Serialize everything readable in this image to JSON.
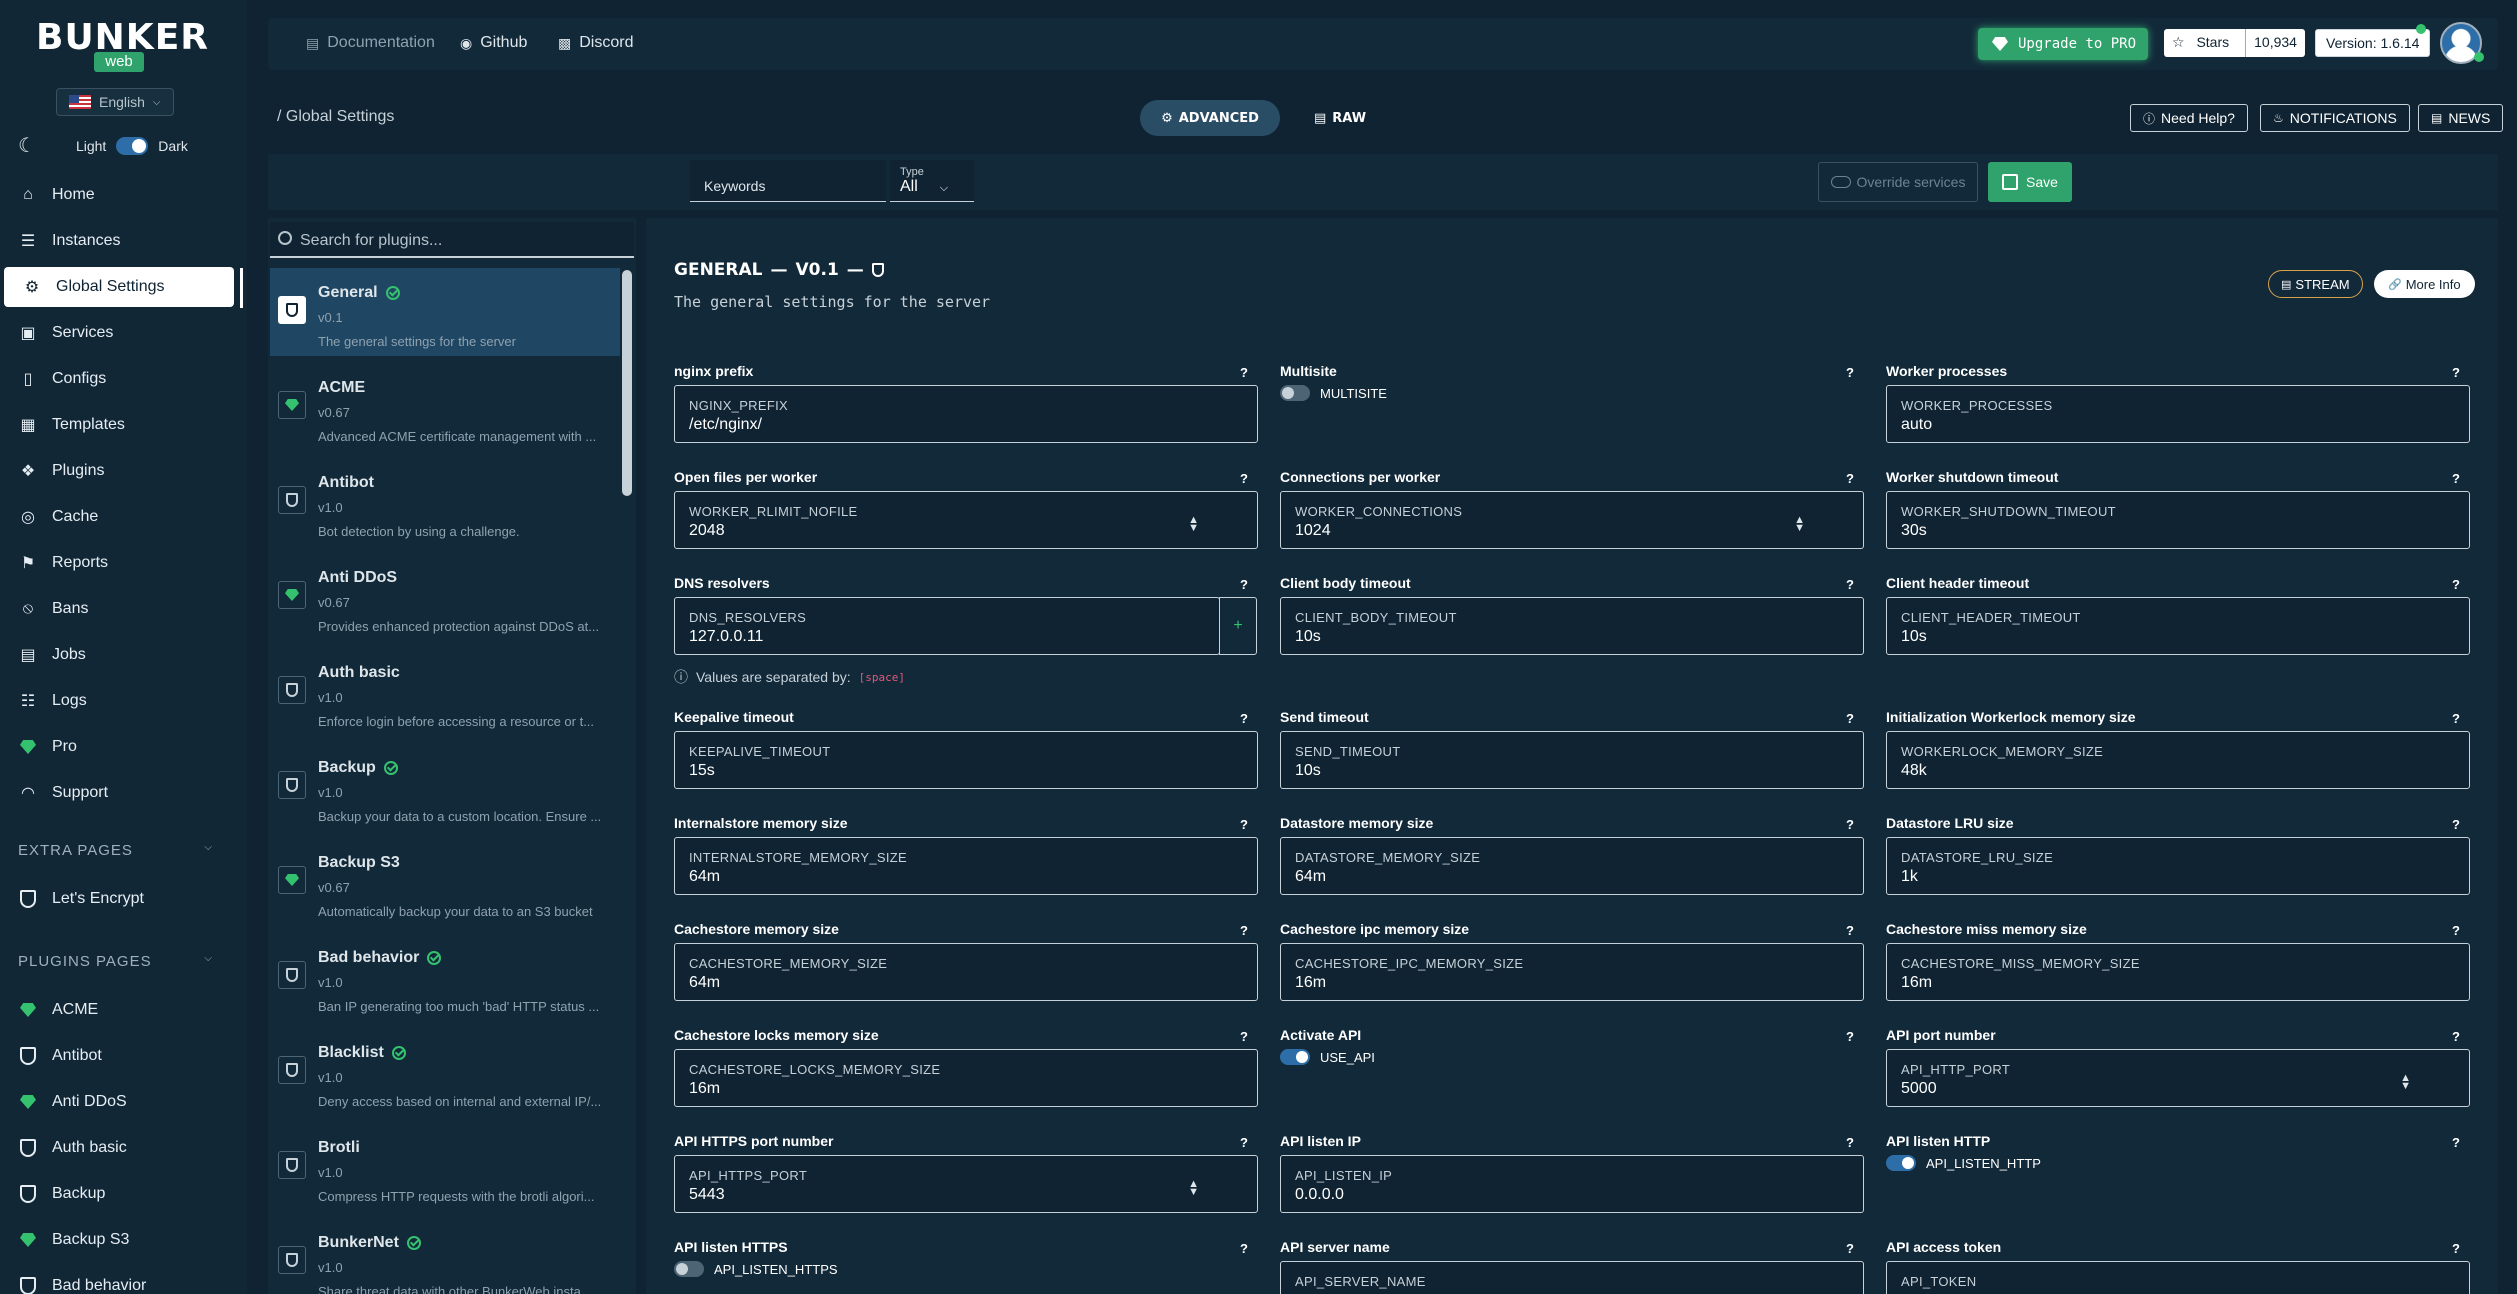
{
  "brand": {
    "name": "BUNKER",
    "sub": "web"
  },
  "language": "English",
  "theme": {
    "light": "Light",
    "dark": "Dark"
  },
  "nav": [
    {
      "label": "Home",
      "icon": "home-icon"
    },
    {
      "label": "Instances",
      "icon": "server-icon"
    },
    {
      "label": "Global Settings",
      "icon": "gear-icon"
    },
    {
      "label": "Services",
      "icon": "cube-icon"
    },
    {
      "label": "Configs",
      "icon": "file-icon"
    },
    {
      "label": "Templates",
      "icon": "layout-icon"
    },
    {
      "label": "Plugins",
      "icon": "puzzle-icon"
    },
    {
      "label": "Cache",
      "icon": "database-icon"
    },
    {
      "label": "Reports",
      "icon": "flag-icon"
    },
    {
      "label": "Bans",
      "icon": "ban-icon"
    },
    {
      "label": "Jobs",
      "icon": "calendar-icon"
    },
    {
      "label": "Logs",
      "icon": "log-icon"
    },
    {
      "label": "Pro",
      "icon": "gem-icon"
    },
    {
      "label": "Support",
      "icon": "headset-icon"
    }
  ],
  "extra_pages": {
    "heading": "EXTRA PAGES",
    "items": [
      "Let's Encrypt"
    ]
  },
  "plugins_pages": {
    "heading": "PLUGINS PAGES",
    "items": [
      "ACME",
      "Antibot",
      "Anti DDoS",
      "Auth basic",
      "Backup",
      "Backup S3",
      "Bad behavior"
    ]
  },
  "header": {
    "links": [
      "Documentation",
      "Github",
      "Discord"
    ],
    "upgrade": "Upgrade to PRO",
    "stars_label": "Stars",
    "stars_count": "10,934",
    "version": "Version: 1.6.14"
  },
  "subheader": {
    "breadcrumb": "/  Global Settings",
    "advanced": "ADVANCED",
    "raw": "RAW",
    "need_help": "Need Help?",
    "notifications": "NOTIFICATIONS",
    "news": "NEWS"
  },
  "toolbar": {
    "keywords": "Keywords",
    "type_label": "Type",
    "type_value": "All",
    "override": "Override services",
    "save": "Save"
  },
  "plugin_search_placeholder": "Search for plugins...",
  "plugins": [
    {
      "name": "General",
      "version": "v0.1",
      "desc": "The general settings for the server",
      "checked": true,
      "icon": "shield"
    },
    {
      "name": "ACME",
      "version": "v0.67",
      "desc": "Advanced ACME certificate management with ...",
      "checked": false,
      "icon": "gem"
    },
    {
      "name": "Antibot",
      "version": "v1.0",
      "desc": "Bot detection by using a challenge.",
      "checked": false,
      "icon": "shield"
    },
    {
      "name": "Anti DDoS",
      "version": "v0.67",
      "desc": "Provides enhanced protection against DDoS at...",
      "checked": false,
      "icon": "gem"
    },
    {
      "name": "Auth basic",
      "version": "v1.0",
      "desc": "Enforce login before accessing a resource or t...",
      "checked": false,
      "icon": "shield"
    },
    {
      "name": "Backup",
      "version": "v1.0",
      "desc": "Backup your data to a custom location. Ensure ...",
      "checked": true,
      "icon": "shield"
    },
    {
      "name": "Backup S3",
      "version": "v0.67",
      "desc": "Automatically backup your data to an S3 bucket",
      "checked": false,
      "icon": "gem"
    },
    {
      "name": "Bad behavior",
      "version": "v1.0",
      "desc": "Ban IP generating too much 'bad' HTTP status ...",
      "checked": true,
      "icon": "shield"
    },
    {
      "name": "Blacklist",
      "version": "v1.0",
      "desc": "Deny access based on internal and external IP/...",
      "checked": true,
      "icon": "shield"
    },
    {
      "name": "Brotli",
      "version": "v1.0",
      "desc": "Compress HTTP requests with the brotli algori...",
      "checked": false,
      "icon": "shield"
    },
    {
      "name": "BunkerNet",
      "version": "v1.0",
      "desc": "Share threat data with other BunkerWeb insta...",
      "checked": true,
      "icon": "shield"
    }
  ],
  "panel": {
    "title": "GENERAL",
    "version": "V0.1",
    "subtitle": "The general settings for the server",
    "stream": "STREAM",
    "more_info": "More Info",
    "hint_text": "Values are separated by:",
    "hint_code": "[space]"
  },
  "fields": [
    {
      "label": "nginx prefix",
      "key": "NGINX_PREFIX",
      "value": "/etc/nginx/",
      "kind": "text"
    },
    {
      "label": "Multisite",
      "key": "MULTISITE",
      "value": "",
      "kind": "toggle",
      "on": false
    },
    {
      "label": "Worker processes",
      "key": "WORKER_PROCESSES",
      "value": "auto",
      "kind": "text"
    },
    {
      "label": "Open files per worker",
      "key": "WORKER_RLIMIT_NOFILE",
      "value": "2048",
      "kind": "number"
    },
    {
      "label": "Connections per worker",
      "key": "WORKER_CONNECTIONS",
      "value": "1024",
      "kind": "number"
    },
    {
      "label": "Worker shutdown timeout",
      "key": "WORKER_SHUTDOWN_TIMEOUT",
      "value": "30s",
      "kind": "text"
    },
    {
      "label": "DNS resolvers",
      "key": "DNS_RESOLVERS",
      "value": "127.0.0.11",
      "kind": "multi"
    },
    {
      "label": "Client body timeout",
      "key": "CLIENT_BODY_TIMEOUT",
      "value": "10s",
      "kind": "text"
    },
    {
      "label": "Client header timeout",
      "key": "CLIENT_HEADER_TIMEOUT",
      "value": "10s",
      "kind": "text"
    },
    {
      "label": "Keepalive timeout",
      "key": "KEEPALIVE_TIMEOUT",
      "value": "15s",
      "kind": "text"
    },
    {
      "label": "Send timeout",
      "key": "SEND_TIMEOUT",
      "value": "10s",
      "kind": "text"
    },
    {
      "label": "Initialization Workerlock memory size",
      "key": "WORKERLOCK_MEMORY_SIZE",
      "value": "48k",
      "kind": "text"
    },
    {
      "label": "Internalstore memory size",
      "key": "INTERNALSTORE_MEMORY_SIZE",
      "value": "64m",
      "kind": "text"
    },
    {
      "label": "Datastore memory size",
      "key": "DATASTORE_MEMORY_SIZE",
      "value": "64m",
      "kind": "text"
    },
    {
      "label": "Datastore LRU size",
      "key": "DATASTORE_LRU_SIZE",
      "value": "1k",
      "kind": "text"
    },
    {
      "label": "Cachestore memory size",
      "key": "CACHESTORE_MEMORY_SIZE",
      "value": "64m",
      "kind": "text"
    },
    {
      "label": "Cachestore ipc memory size",
      "key": "CACHESTORE_IPC_MEMORY_SIZE",
      "value": "16m",
      "kind": "text"
    },
    {
      "label": "Cachestore miss memory size",
      "key": "CACHESTORE_MISS_MEMORY_SIZE",
      "value": "16m",
      "kind": "text"
    },
    {
      "label": "Cachestore locks memory size",
      "key": "CACHESTORE_LOCKS_MEMORY_SIZE",
      "value": "16m",
      "kind": "text"
    },
    {
      "label": "Activate API",
      "key": "USE_API",
      "value": "",
      "kind": "toggle",
      "on": true
    },
    {
      "label": "API port number",
      "key": "API_HTTP_PORT",
      "value": "5000",
      "kind": "number"
    },
    {
      "label": "API HTTPS port number",
      "key": "API_HTTPS_PORT",
      "value": "5443",
      "kind": "number"
    },
    {
      "label": "API listen IP",
      "key": "API_LISTEN_IP",
      "value": "0.0.0.0",
      "kind": "text"
    },
    {
      "label": "API listen HTTP",
      "key": "API_LISTEN_HTTP",
      "value": "",
      "kind": "toggle",
      "on": true
    },
    {
      "label": "API listen HTTPS",
      "key": "API_LISTEN_HTTPS",
      "value": "",
      "kind": "toggle",
      "on": false
    },
    {
      "label": "API server name",
      "key": "API_SERVER_NAME",
      "value": "",
      "kind": "text"
    },
    {
      "label": "API access token",
      "key": "API_TOKEN",
      "value": "",
      "kind": "text"
    }
  ],
  "help_mark": "?"
}
